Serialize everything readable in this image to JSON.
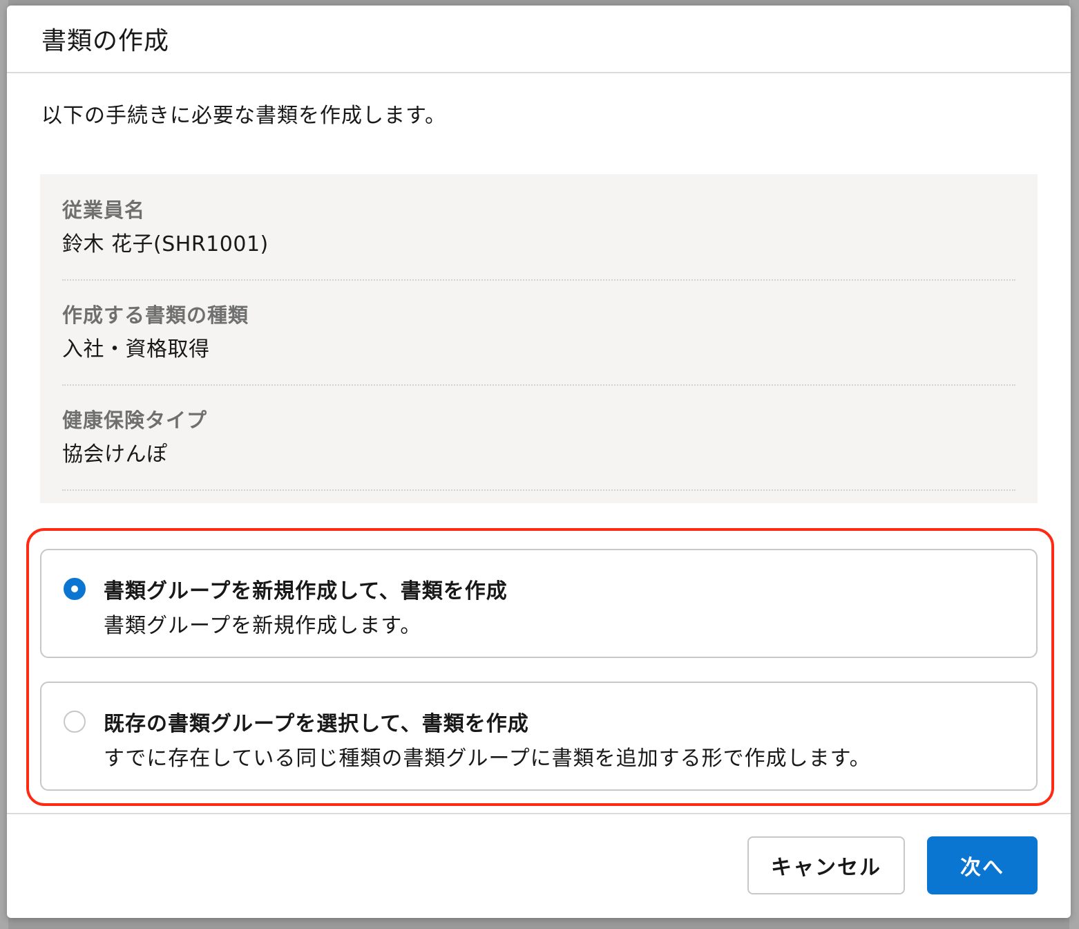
{
  "dialog": {
    "title": "書類の作成",
    "intro": "以下の手続きに必要な書類を作成します。"
  },
  "info": {
    "employee_label": "従業員名",
    "employee_value": "鈴木 花子(SHR1001)",
    "doc_type_label": "作成する書類の種類",
    "doc_type_value": "入社・資格取得",
    "insurance_label": "健康保険タイプ",
    "insurance_value": "協会けんぽ"
  },
  "options": [
    {
      "title": "書類グループを新規作成して、書類を作成",
      "description": "書類グループを新規作成します。",
      "selected": true
    },
    {
      "title": "既存の書類グループを選択して、書類を作成",
      "description": "すでに存在している同じ種類の書類グループに書類を追加する形で作成します。",
      "selected": false
    }
  ],
  "footer": {
    "cancel_label": "キャンセル",
    "next_label": "次へ"
  },
  "colors": {
    "accent": "#0b76d1",
    "highlight": "#ff2a14"
  }
}
